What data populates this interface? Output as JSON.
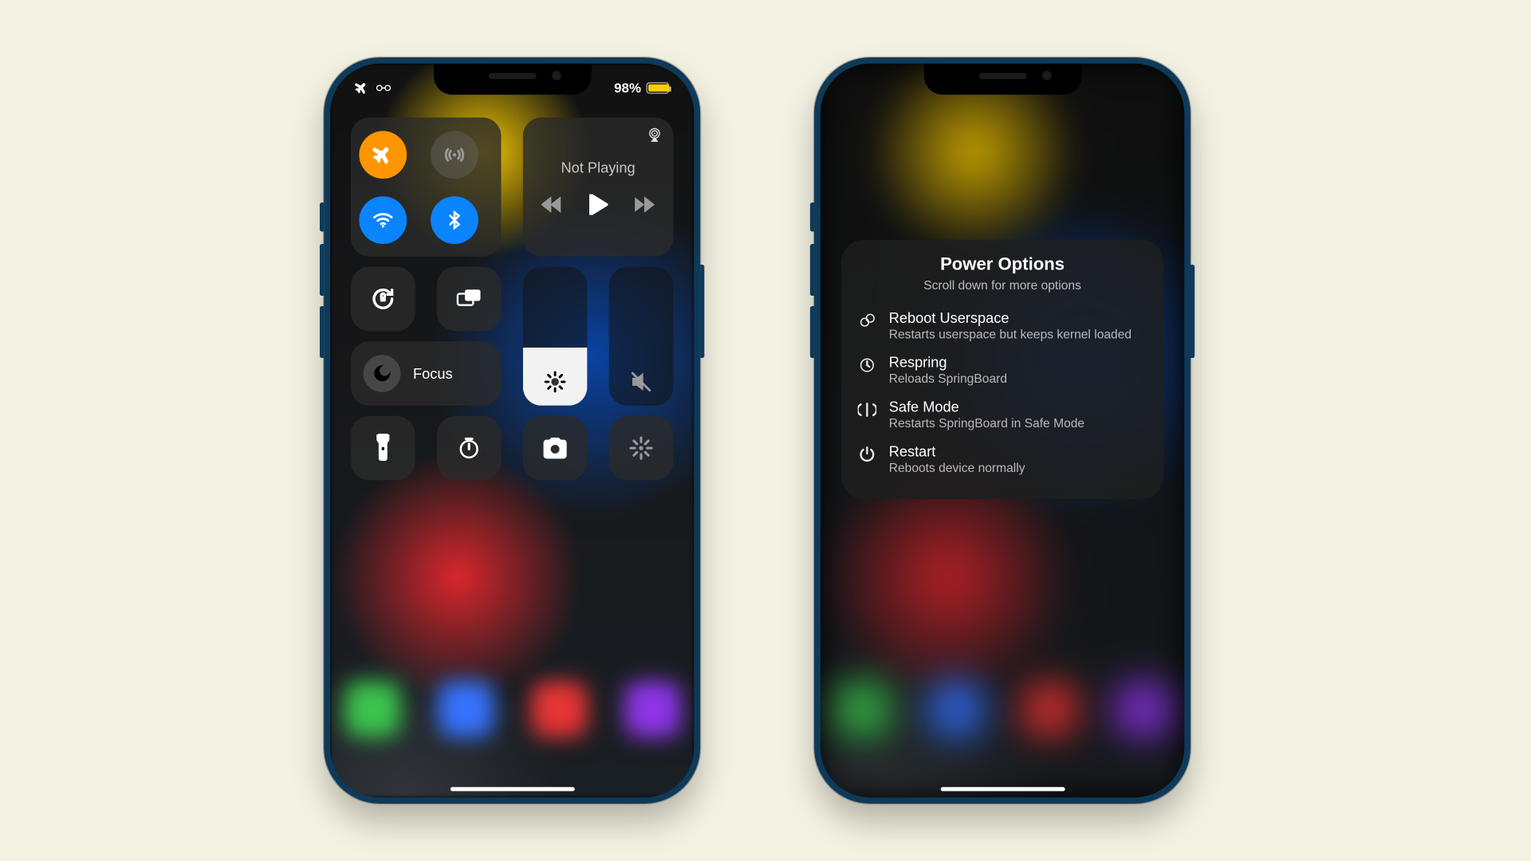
{
  "status": {
    "battery_text": "98%",
    "battery_level": 0.98
  },
  "cc": {
    "media_title": "Not Playing",
    "focus_label": "Focus",
    "brightness_level": 0.42,
    "volume_level": 0.0
  },
  "menu": {
    "title": "Power Options",
    "subtitle": "Scroll down for more options",
    "items": [
      {
        "title": "Reboot Userspace",
        "desc": "Restarts userspace but keeps kernel loaded"
      },
      {
        "title": "Respring",
        "desc": "Reloads SpringBoard"
      },
      {
        "title": "Safe Mode",
        "desc": "Restarts SpringBoard in Safe Mode"
      },
      {
        "title": "Restart",
        "desc": "Reboots device normally"
      }
    ]
  }
}
